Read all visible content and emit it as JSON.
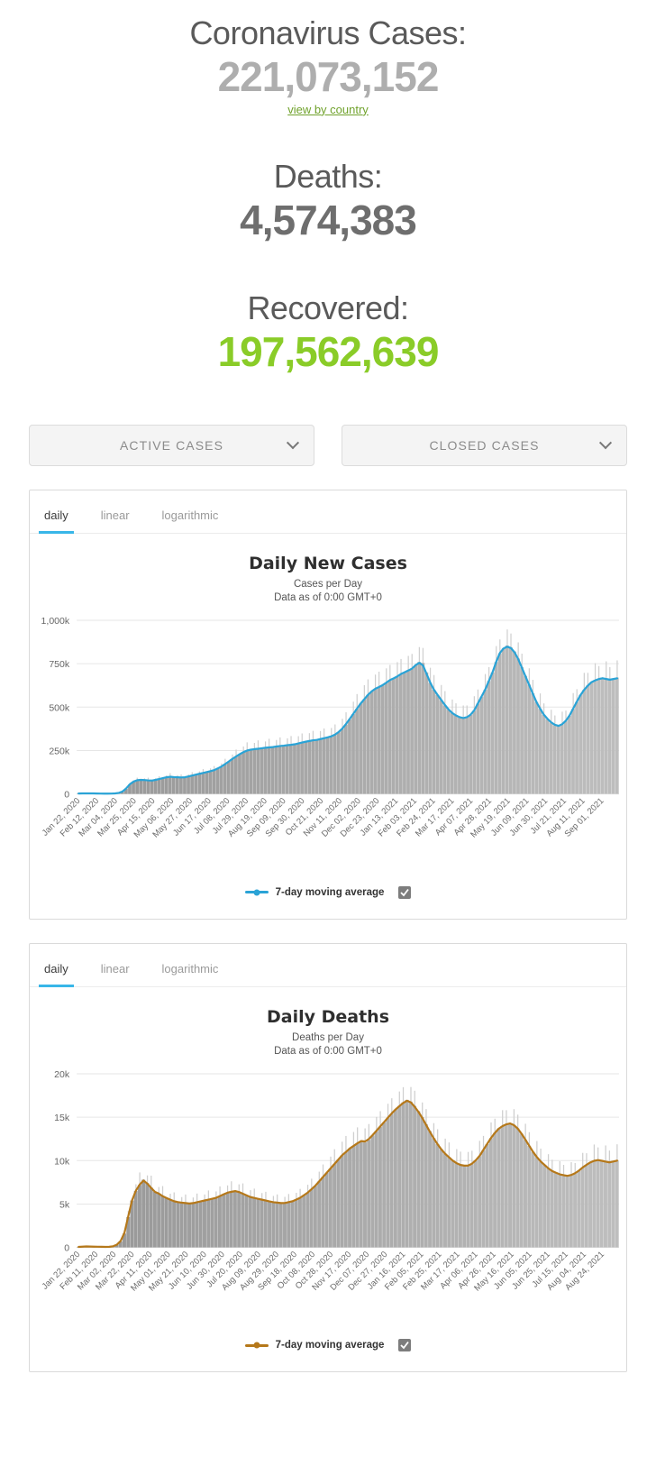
{
  "counters": [
    {
      "label": "Coronavirus Cases:",
      "value": "221,073,152",
      "color": "#aeaeae",
      "link": "view by country"
    },
    {
      "label": "Deaths:",
      "value": "4,574,383",
      "color": "#6e6e6e"
    },
    {
      "label": "Recovered:",
      "value": "197,562,639",
      "color": "#8ACC28"
    }
  ],
  "dropdowns": [
    {
      "label": "ACTIVE CASES",
      "icon": "chevron-down-icon"
    },
    {
      "label": "CLOSED CASES",
      "icon": "chevron-down-icon"
    }
  ],
  "charts": [
    {
      "tabs": [
        {
          "label": "daily",
          "active": true
        },
        {
          "label": "linear",
          "active": false
        },
        {
          "label": "logarithmic",
          "active": false
        }
      ],
      "legend": {
        "text": "7-day moving average",
        "color": "#2aa3d6",
        "checked": true
      },
      "chart_data": {
        "type": "bar",
        "title": "Daily New Cases",
        "subtitle_1": "Cases per Day",
        "subtitle_2": "Data as of 0:00 GMT+0",
        "xlabel": "",
        "ylabel": "",
        "ylim": [
          0,
          1000000
        ],
        "grid": true,
        "legend_position": "bottom",
        "ytick_labels": [
          "1,000k",
          "750k",
          "500k",
          "250k",
          "0"
        ],
        "ytick_values": [
          1000000,
          750000,
          500000,
          250000,
          0
        ],
        "categories": [
          "Jan 22, 2020",
          "Feb 12, 2020",
          "Mar 04, 2020",
          "Mar 25, 2020",
          "Apr 15, 2020",
          "May 06, 2020",
          "May 27, 2020",
          "Jun 17, 2020",
          "Jul 08, 2020",
          "Jul 29, 2020",
          "Aug 19, 2020",
          "Sep 09, 2020",
          "Sep 30, 2020",
          "Oct 21, 2020",
          "Nov 11, 2020",
          "Dec 02, 2020",
          "Dec 23, 2020",
          "Jan 13, 2021",
          "Feb 03, 2021",
          "Feb 24, 2021",
          "Mar 17, 2021",
          "Apr 07, 2021",
          "Apr 28, 2021",
          "May 19, 2021",
          "Jun 09, 2021",
          "Jun 30, 2021",
          "Jul 21, 2021",
          "Aug 11, 2021",
          "Sep 01, 2021"
        ],
        "series": [
          {
            "name": "Cases per Day",
            "type": "bar",
            "values": [
              2000,
              3000,
              4000,
              3500,
              3000,
              2500,
              2200,
              2000,
              1800,
              2000,
              3000,
              5000,
              12000,
              30000,
              55000,
              70000,
              78000,
              82000,
              80000,
              78000,
              76000,
              80000,
              85000,
              90000,
              95000,
              100000,
              98000,
              96000,
              94000,
              95000,
              100000,
              105000,
              110000,
              115000,
              120000,
              125000,
              130000,
              135000,
              145000,
              155000,
              170000,
              185000,
              200000,
              215000,
              228000,
              240000,
              250000,
              255000,
              258000,
              260000,
              262000,
              265000,
              268000,
              270000,
              272000,
              275000,
              278000,
              280000,
              282000,
              285000,
              290000,
              295000,
              300000,
              305000,
              308000,
              310000,
              315000,
              320000,
              325000,
              330000,
              340000,
              355000,
              375000,
              400000,
              430000,
              460000,
              490000,
              520000,
              545000,
              570000,
              590000,
              605000,
              615000,
              625000,
              640000,
              655000,
              665000,
              675000,
              690000,
              700000,
              710000,
              720000,
              740000,
              760000,
              755000,
              700000,
              640000,
              600000,
              570000,
              540000,
              510000,
              485000,
              465000,
              450000,
              440000,
              435000,
              440000,
              455000,
              480000,
              520000,
              560000,
              600000,
              650000,
              700000,
              760000,
              810000,
              840000,
              855000,
              845000,
              820000,
              780000,
              730000,
              680000,
              630000,
              580000,
              530000,
              490000,
              455000,
              430000,
              410000,
              395000,
              390000,
              400000,
              420000,
              450000,
              490000,
              530000,
              570000,
              600000,
              625000,
              645000,
              655000,
              665000,
              670000,
              665000,
              660000,
              665000,
              670000
            ]
          },
          {
            "name": "7-day moving average",
            "type": "line",
            "color": "#2aa3d6",
            "values": [
              2500,
              3000,
              3400,
              3200,
              2900,
              2500,
              2200,
              2000,
              1900,
              2100,
              3200,
              6000,
              14000,
              32000,
              56000,
              71000,
              79000,
              81000,
              80000,
              78000,
              77000,
              81000,
              86000,
              91000,
              96000,
              99000,
              97000,
              96000,
              95000,
              96000,
              101000,
              106000,
              111000,
              116000,
              121000,
              126000,
              131000,
              137000,
              147000,
              158000,
              172000,
              187000,
              202000,
              216000,
              229000,
              241000,
              250000,
              255000,
              258000,
              260000,
              263000,
              266000,
              268000,
              270000,
              273000,
              276000,
              278000,
              281000,
              283000,
              286000,
              291000,
              296000,
              301000,
              305000,
              309000,
              311000,
              316000,
              321000,
              326000,
              332000,
              342000,
              357000,
              377000,
              403000,
              432000,
              462000,
              492000,
              521000,
              546000,
              571000,
              591000,
              606000,
              616000,
              627000,
              641000,
              656000,
              666000,
              677000,
              691000,
              701000,
              711000,
              722000,
              742000,
              755000,
              740000,
              690000,
              640000,
              600000,
              570000,
              541000,
              512000,
              486000,
              466000,
              452000,
              442000,
              437000,
              442000,
              457000,
              482000,
              522000,
              562000,
              602000,
              652000,
              702000,
              762000,
              812000,
              838000,
              848000,
              840000,
              815000,
              776000,
              726000,
              676000,
              626000,
              576000,
              528000,
              490000,
              456000,
              432000,
              412000,
              398000,
              392000,
              402000,
              422000,
              452000,
              492000,
              532000,
              570000,
              600000,
              624000,
              644000,
              654000,
              662000,
              666000,
              662000,
              658000,
              662000,
              666000
            ]
          }
        ]
      }
    },
    {
      "tabs": [
        {
          "label": "daily",
          "active": true
        },
        {
          "label": "linear",
          "active": false
        },
        {
          "label": "logarithmic",
          "active": false
        }
      ],
      "legend": {
        "text": "7-day moving average",
        "color": "#b5781a",
        "checked": true
      },
      "chart_data": {
        "type": "bar",
        "title": "Daily Deaths",
        "subtitle_1": "Deaths per Day",
        "subtitle_2": "Data as of 0:00 GMT+0",
        "xlabel": "",
        "ylabel": "",
        "ylim": [
          0,
          20000
        ],
        "grid": true,
        "legend_position": "bottom",
        "ytick_labels": [
          "20k",
          "15k",
          "10k",
          "5k",
          "0"
        ],
        "ytick_values": [
          20000,
          15000,
          10000,
          5000,
          0
        ],
        "categories": [
          "Jan 22, 2020",
          "Feb 11, 2020",
          "Mar 02, 2020",
          "Mar 22, 2020",
          "Apr 11, 2020",
          "May 01, 2020",
          "May 21, 2020",
          "Jun 10, 2020",
          "Jun 30, 2020",
          "Jul 20, 2020",
          "Aug 09, 2020",
          "Aug 29, 2020",
          "Sep 18, 2020",
          "Oct 08, 2020",
          "Oct 28, 2020",
          "Nov 17, 2020",
          "Dec 07, 2020",
          "Dec 27, 2020",
          "Jan 16, 2021",
          "Feb 05, 2021",
          "Feb 25, 2021",
          "Mar 17, 2021",
          "Apr 06, 2021",
          "Apr 26, 2021",
          "May 16, 2021",
          "Jun 05, 2021",
          "Jun 25, 2021",
          "Jul 15, 2021",
          "Aug 04, 2021",
          "Aug 24, 2021"
        ],
        "series": [
          {
            "name": "Deaths per Day",
            "type": "bar",
            "values": [
              50,
              80,
              120,
              100,
              90,
              80,
              70,
              60,
              70,
              120,
              300,
              700,
              1600,
              3500,
              5400,
              6500,
              7200,
              7800,
              7400,
              6900,
              6400,
              6200,
              5900,
              5700,
              5500,
              5300,
              5200,
              5150,
              5100,
              5050,
              5100,
              5200,
              5300,
              5400,
              5500,
              5600,
              5700,
              5900,
              6100,
              6300,
              6400,
              6500,
              6400,
              6200,
              6000,
              5800,
              5700,
              5600,
              5500,
              5400,
              5300,
              5200,
              5150,
              5100,
              5100,
              5200,
              5300,
              5500,
              5700,
              6000,
              6300,
              6700,
              7100,
              7600,
              8100,
              8600,
              9100,
              9600,
              10100,
              10600,
              11000,
              11400,
              11700,
              12000,
              12300,
              12100,
              12400,
              12900,
              13400,
              13900,
              14400,
              14900,
              15400,
              15900,
              16300,
              16700,
              17000,
              16800,
              16300,
              15700,
              15000,
              14200,
              13400,
              12600,
              11900,
              11300,
              10800,
              10400,
              10000,
              9700,
              9500,
              9400,
              9400,
              9600,
              10000,
              10500,
              11200,
              11900,
              12600,
              13200,
              13700,
              14000,
              14200,
              14300,
              14100,
              13700,
              13100,
              12400,
              11700,
              11000,
              10400,
              9900,
              9500,
              9100,
              8800,
              8600,
              8400,
              8300,
              8200,
              8300,
              8500,
              8800,
              9200,
              9500,
              9800,
              10000,
              10100,
              10000,
              9900,
              9800,
              9900,
              10000
            ]
          },
          {
            "name": "7-day moving average",
            "type": "line",
            "color": "#b5781a",
            "values": [
              60,
              85,
              110,
              100,
              92,
              82,
              72,
              64,
              75,
              130,
              320,
              740,
              1700,
              3600,
              5450,
              6550,
              7250,
              7700,
              7350,
              6850,
              6400,
              6200,
              5900,
              5700,
              5500,
              5320,
              5220,
              5160,
              5110,
              5060,
              5110,
              5210,
              5310,
              5410,
              5510,
              5610,
              5720,
              5920,
              6120,
              6310,
              6410,
              6490,
              6380,
              6190,
              5990,
              5800,
              5700,
              5600,
              5500,
              5400,
              5300,
              5210,
              5160,
              5110,
              5120,
              5220,
              5320,
              5520,
              5720,
              6020,
              6320,
              6720,
              7120,
              7620,
              8120,
              8620,
              9120,
              9620,
              10120,
              10620,
              11000,
              11400,
              11700,
              12000,
              12250,
              12200,
              12500,
              12950,
              13450,
              13950,
              14450,
              14950,
              15450,
              15900,
              16280,
              16650,
              16900,
              16700,
              16200,
              15600,
              14900,
              14100,
              13300,
              12550,
              11880,
              11280,
              10780,
              10380,
              9990,
              9700,
              9500,
              9420,
              9430,
              9650,
              10050,
              10550,
              11250,
              11950,
              12620,
              13200,
              13680,
              13980,
              14180,
              14280,
              14080,
              13680,
              13080,
              12400,
              11700,
              11000,
              10400,
              9900,
              9500,
              9100,
              8800,
              8600,
              8420,
              8320,
              8250,
              8350,
              8550,
              8850,
              9220,
              9520,
              9800,
              9980,
              10060,
              9980,
              9880,
              9800,
              9900,
              10000
            ]
          }
        ]
      }
    }
  ]
}
